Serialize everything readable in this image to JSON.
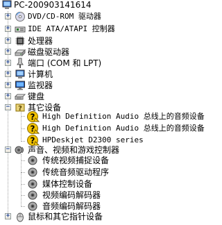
{
  "root": {
    "label": "PC-200903141614",
    "icon": "computer-icon"
  },
  "categories": [
    {
      "label": "DVD/CD-ROM 驱动器",
      "icon": "cdrom-icon",
      "expanded": false
    },
    {
      "label": "IDE ATA/ATAPI 控制器",
      "icon": "ide-controller-icon",
      "expanded": false
    },
    {
      "label": "处理器",
      "icon": "processor-icon",
      "expanded": false
    },
    {
      "label": "磁盘驱动器",
      "icon": "disk-drive-icon",
      "expanded": false
    },
    {
      "label": "端口 (COM 和 LPT)",
      "icon": "port-icon",
      "expanded": false
    },
    {
      "label": "计算机",
      "icon": "computer-icon",
      "expanded": false
    },
    {
      "label": "监视器",
      "icon": "monitor-icon",
      "expanded": false
    },
    {
      "label": "键盘",
      "icon": "keyboard-icon",
      "expanded": false
    },
    {
      "label": "其它设备",
      "icon": "unknown-device-icon",
      "expanded": true,
      "children": [
        {
          "label": "High Definition Audio 总线上的音频设备",
          "icon": "warning-device-icon"
        },
        {
          "label": "High Definition Audio 总线上的音频设备",
          "icon": "warning-device-icon"
        },
        {
          "label": "HPDeskjet D2300 series",
          "icon": "warning-device-icon"
        }
      ]
    },
    {
      "label": "声音、视频和游戏控制器",
      "icon": "sound-controller-icon",
      "expanded": true,
      "children": [
        {
          "label": "传统视频捕捉设备",
          "icon": "speaker-icon"
        },
        {
          "label": "传统音频驱动程序",
          "icon": "speaker-icon"
        },
        {
          "label": "媒体控制设备",
          "icon": "speaker-icon"
        },
        {
          "label": "视频编码解码器",
          "icon": "speaker-icon"
        },
        {
          "label": "音频编码解码器",
          "icon": "speaker-icon"
        }
      ]
    },
    {
      "label": "鼠标和其它指针设备",
      "icon": "mouse-icon",
      "expanded": false
    }
  ]
}
